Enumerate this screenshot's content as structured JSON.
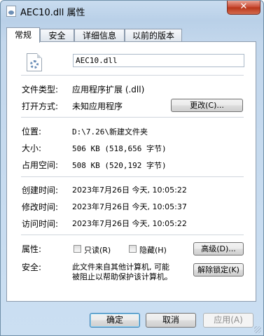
{
  "window": {
    "title": "AEC10.dll 属性",
    "close_glyph": "✕"
  },
  "tabs": [
    {
      "label": "常规"
    },
    {
      "label": "安全"
    },
    {
      "label": "详细信息"
    },
    {
      "label": "以前的版本"
    }
  ],
  "file": {
    "name": "AEC10.dll",
    "icon": "dll-file-icon"
  },
  "general": {
    "type_label": "文件类型:",
    "type_value": "应用程序扩展 (.dll)",
    "opens_with_label": "打开方式:",
    "opens_with_value": "未知应用程序",
    "change_button": "更改(C)...",
    "location_label": "位置:",
    "location_value": "D:\\7.26\\新建文件夹",
    "size_label": "大小:",
    "size_value": "506 KB (518,656 字节)",
    "size_on_disk_label": "占用空间:",
    "size_on_disk_value": "508 KB (520,192 字节)",
    "created_label": "创建时间:",
    "created_value": "2023年7月26日 今天, 10:05:22",
    "modified_label": "修改时间:",
    "modified_value": "2023年7月26日 今天, 10:05:37",
    "accessed_label": "访问时间:",
    "accessed_value": "2023年7月26日 今天, 10:05:22",
    "attributes_label": "属性:",
    "readonly_label": "只读(R)",
    "hidden_label": "隐藏(H)",
    "advanced_button": "高级(D)...",
    "security_label": "安全:",
    "security_text_1": "此文件来自其他计算机, 可能",
    "security_text_2": "被阻止以帮助保护该计算机。",
    "unblock_button": "解除锁定(K)"
  },
  "footer": {
    "ok": "确定",
    "cancel": "取消",
    "apply": "应用(A)"
  }
}
